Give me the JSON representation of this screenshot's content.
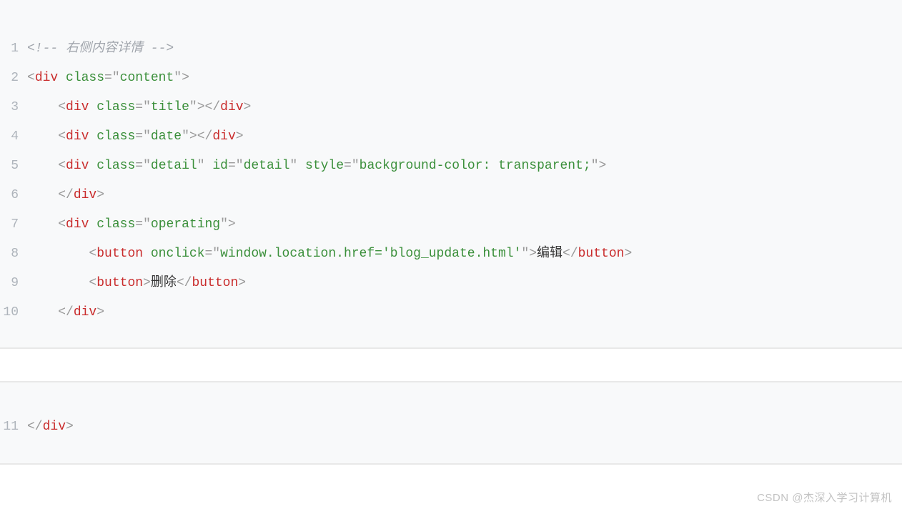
{
  "block1": {
    "lines": [
      {
        "n": "1",
        "segs": [
          {
            "cls": "comment",
            "t": "<!-- 右侧内容详情 -->"
          }
        ],
        "indent": 0
      },
      {
        "n": "2",
        "segs": [
          {
            "cls": "punct",
            "t": "<"
          },
          {
            "cls": "tagname",
            "t": "div"
          },
          {
            "cls": "plain",
            "t": " "
          },
          {
            "cls": "attr-name",
            "t": "class"
          },
          {
            "cls": "punct",
            "t": "="
          },
          {
            "cls": "punct",
            "t": "\""
          },
          {
            "cls": "attr-val",
            "t": "content"
          },
          {
            "cls": "punct",
            "t": "\""
          },
          {
            "cls": "punct",
            "t": ">"
          }
        ],
        "indent": 0
      },
      {
        "n": "3",
        "segs": [
          {
            "cls": "punct",
            "t": "<"
          },
          {
            "cls": "tagname",
            "t": "div"
          },
          {
            "cls": "plain",
            "t": " "
          },
          {
            "cls": "attr-name",
            "t": "class"
          },
          {
            "cls": "punct",
            "t": "="
          },
          {
            "cls": "punct",
            "t": "\""
          },
          {
            "cls": "attr-val",
            "t": "title"
          },
          {
            "cls": "punct",
            "t": "\""
          },
          {
            "cls": "punct",
            "t": ">"
          },
          {
            "cls": "punct",
            "t": "</"
          },
          {
            "cls": "tagname",
            "t": "div"
          },
          {
            "cls": "punct",
            "t": ">"
          }
        ],
        "indent": 1
      },
      {
        "n": "4",
        "segs": [
          {
            "cls": "punct",
            "t": "<"
          },
          {
            "cls": "tagname",
            "t": "div"
          },
          {
            "cls": "plain",
            "t": " "
          },
          {
            "cls": "attr-name",
            "t": "class"
          },
          {
            "cls": "punct",
            "t": "="
          },
          {
            "cls": "punct",
            "t": "\""
          },
          {
            "cls": "attr-val",
            "t": "date"
          },
          {
            "cls": "punct",
            "t": "\""
          },
          {
            "cls": "punct",
            "t": ">"
          },
          {
            "cls": "punct",
            "t": "</"
          },
          {
            "cls": "tagname",
            "t": "div"
          },
          {
            "cls": "punct",
            "t": ">"
          }
        ],
        "indent": 1
      },
      {
        "n": "5",
        "segs": [
          {
            "cls": "punct",
            "t": "<"
          },
          {
            "cls": "tagname",
            "t": "div"
          },
          {
            "cls": "plain",
            "t": " "
          },
          {
            "cls": "attr-name",
            "t": "class"
          },
          {
            "cls": "punct",
            "t": "="
          },
          {
            "cls": "punct",
            "t": "\""
          },
          {
            "cls": "attr-val",
            "t": "detail"
          },
          {
            "cls": "punct",
            "t": "\""
          },
          {
            "cls": "plain",
            "t": " "
          },
          {
            "cls": "attr-name",
            "t": "id"
          },
          {
            "cls": "punct",
            "t": "="
          },
          {
            "cls": "punct",
            "t": "\""
          },
          {
            "cls": "attr-val",
            "t": "detail"
          },
          {
            "cls": "punct",
            "t": "\""
          },
          {
            "cls": "plain",
            "t": " "
          },
          {
            "cls": "attr-name",
            "t": "style"
          },
          {
            "cls": "punct",
            "t": "="
          },
          {
            "cls": "punct",
            "t": "\""
          },
          {
            "cls": "attr-val",
            "t": "background-color: transparent;"
          },
          {
            "cls": "punct",
            "t": "\""
          },
          {
            "cls": "punct",
            "t": ">"
          }
        ],
        "indent": 1
      },
      {
        "n": "6",
        "segs": [
          {
            "cls": "punct",
            "t": "</"
          },
          {
            "cls": "tagname",
            "t": "div"
          },
          {
            "cls": "punct",
            "t": ">"
          }
        ],
        "indent": 1
      },
      {
        "n": "7",
        "segs": [
          {
            "cls": "punct",
            "t": "<"
          },
          {
            "cls": "tagname",
            "t": "div"
          },
          {
            "cls": "plain",
            "t": " "
          },
          {
            "cls": "attr-name",
            "t": "class"
          },
          {
            "cls": "punct",
            "t": "="
          },
          {
            "cls": "punct",
            "t": "\""
          },
          {
            "cls": "attr-val",
            "t": "operating"
          },
          {
            "cls": "punct",
            "t": "\""
          },
          {
            "cls": "punct",
            "t": ">"
          }
        ],
        "indent": 1
      },
      {
        "n": "8",
        "segs": [
          {
            "cls": "punct",
            "t": "<"
          },
          {
            "cls": "tagname",
            "t": "button"
          },
          {
            "cls": "plain",
            "t": " "
          },
          {
            "cls": "attr-name",
            "t": "onclick"
          },
          {
            "cls": "punct",
            "t": "="
          },
          {
            "cls": "punct",
            "t": "\""
          },
          {
            "cls": "attr-val",
            "t": "window.location.href='blog_update.html'"
          },
          {
            "cls": "punct",
            "t": "\""
          },
          {
            "cls": "punct",
            "t": ">"
          },
          {
            "cls": "plain",
            "t": "编辑"
          },
          {
            "cls": "punct",
            "t": "</"
          },
          {
            "cls": "tagname",
            "t": "button"
          },
          {
            "cls": "punct",
            "t": ">"
          }
        ],
        "indent": 2
      },
      {
        "n": "9",
        "segs": [
          {
            "cls": "punct",
            "t": "<"
          },
          {
            "cls": "tagname",
            "t": "button"
          },
          {
            "cls": "punct",
            "t": ">"
          },
          {
            "cls": "plain",
            "t": "删除"
          },
          {
            "cls": "punct",
            "t": "</"
          },
          {
            "cls": "tagname",
            "t": "button"
          },
          {
            "cls": "punct",
            "t": ">"
          }
        ],
        "indent": 2
      },
      {
        "n": "10",
        "segs": [
          {
            "cls": "punct",
            "t": "</"
          },
          {
            "cls": "tagname",
            "t": "div"
          },
          {
            "cls": "punct",
            "t": ">"
          }
        ],
        "indent": 1
      }
    ]
  },
  "block2": {
    "lines": [
      {
        "n": "11",
        "segs": [
          {
            "cls": "punct",
            "t": "</"
          },
          {
            "cls": "tagname",
            "t": "div"
          },
          {
            "cls": "punct",
            "t": ">"
          }
        ],
        "indent": 0
      }
    ]
  },
  "watermark": "CSDN @杰深入学习计算机"
}
